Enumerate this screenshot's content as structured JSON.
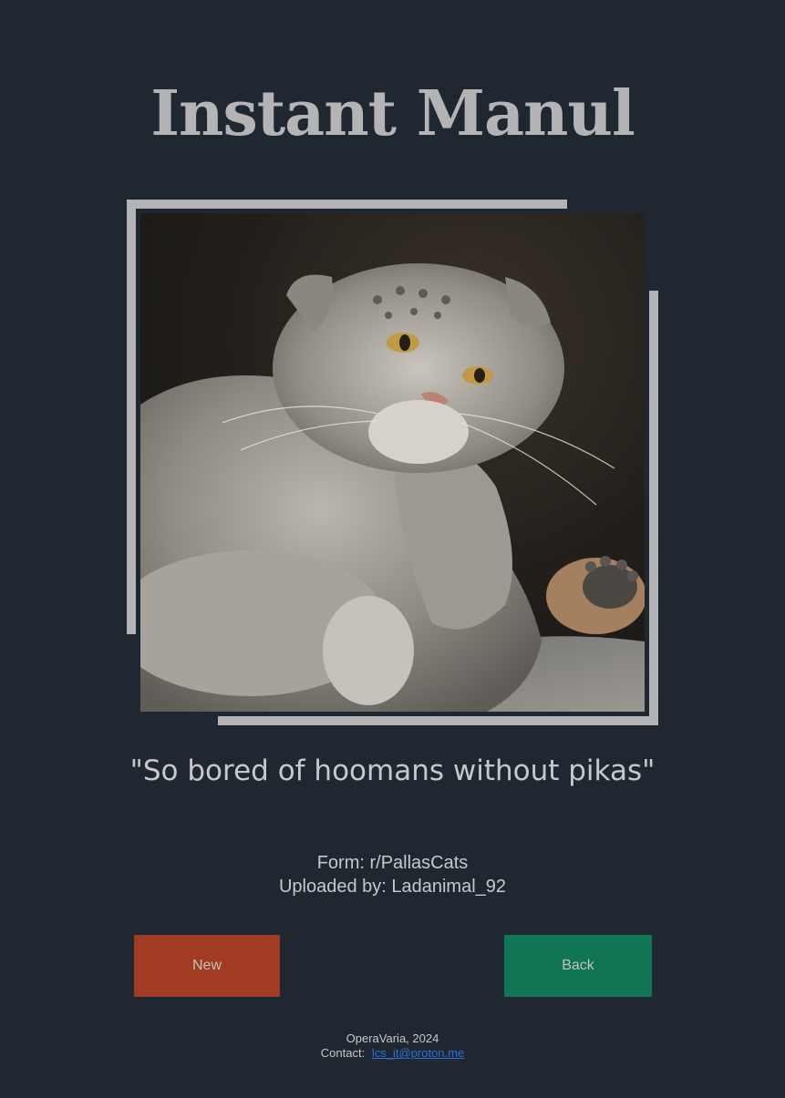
{
  "header": {
    "title": "Instant Manul"
  },
  "photo": {
    "alt": "Pallas's cat resting chin on paw",
    "frame_color": "#b4b3b6"
  },
  "caption": {
    "quote": "\"So bored of hoomans without pikas\""
  },
  "meta": {
    "source": "Form: r/PallasCats",
    "uploader": "Uploaded by: Ladanimal_92"
  },
  "actions": {
    "new_label": "New",
    "new_color": "#a13b21",
    "back_label": "Back",
    "back_color": "#0f7555"
  },
  "footer": {
    "credit": "OperaVaria, 2024",
    "contact_label": "Contact:",
    "contact_email": "lcs_it@proton.me",
    "contact_href": "mailto:lcs_it@proton.me"
  },
  "colors": {
    "background": "#1f2731",
    "title": "#b4b3b6",
    "text": "#c8c8cc",
    "link": "#2e6fd8"
  }
}
